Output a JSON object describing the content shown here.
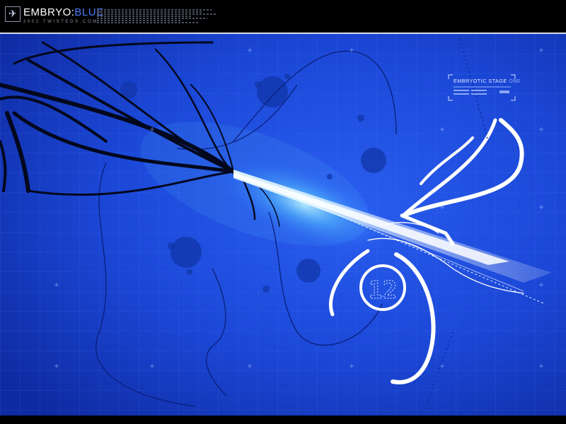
{
  "header": {
    "brand_main": "EMBRYO",
    "brand_separator": ":",
    "brand_accent": "BLUE",
    "subline": "2002 TWISTEDS.COM"
  },
  "panel": {
    "stage_title": "EMBRYOTIC STAGE",
    "stage_suffix": "ONE"
  },
  "graphic": {
    "number_glyph": "12"
  },
  "colors": {
    "background_blue": "#1a44d8",
    "accent_blue": "#4d7cff",
    "header_black": "#000000",
    "stroke_white": "#ffffff"
  },
  "icons": [
    "logo-emblem-icon"
  ]
}
